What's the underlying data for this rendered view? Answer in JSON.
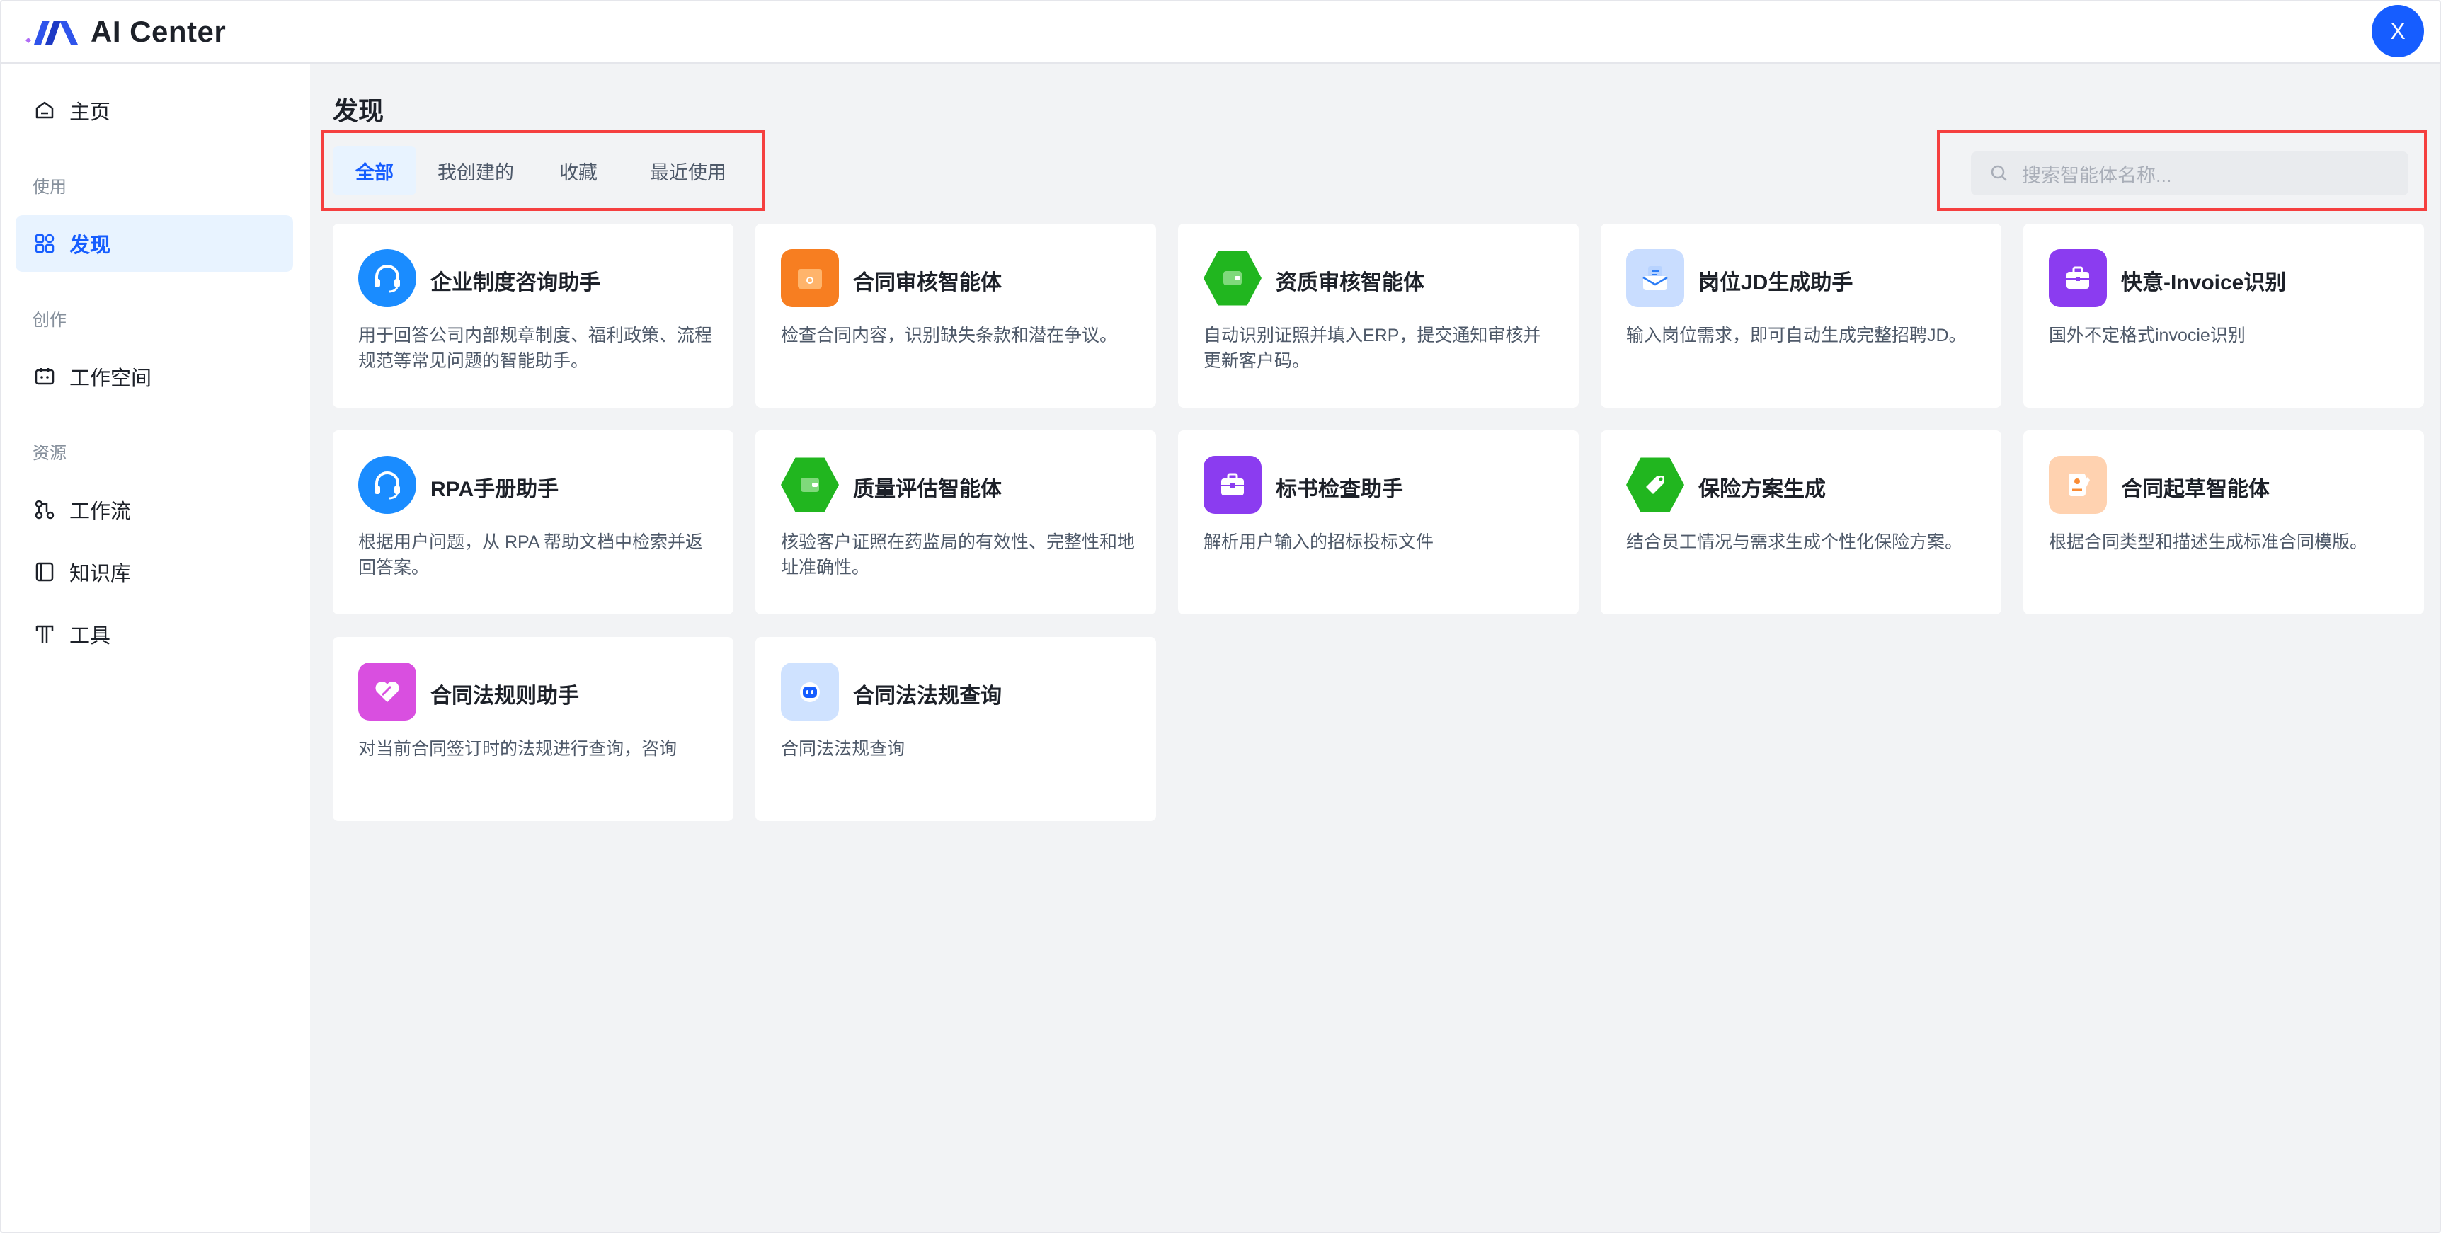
{
  "app": {
    "title": "AI Center",
    "avatar_letter": "X"
  },
  "sidebar": {
    "home": "主页",
    "group_use": "使用",
    "discover": "发现",
    "group_create": "创作",
    "workspace": "工作空间",
    "group_resources": "资源",
    "workflow": "工作流",
    "knowledge": "知识库",
    "tools": "工具"
  },
  "main": {
    "title": "发现",
    "tabs": [
      {
        "label": "全部",
        "active": true
      },
      {
        "label": "我创建的",
        "active": false
      },
      {
        "label": "收藏",
        "active": false
      },
      {
        "label": "最近使用",
        "active": false
      }
    ],
    "search": {
      "placeholder": "搜索智能体名称..."
    },
    "cards": [
      {
        "title": "企业制度咨询助手",
        "desc": "用于回答公司内部规章制度、福利政策、流程规范等常见问题的智能助手。",
        "icon": "headset-icon",
        "color": "#1a8cff"
      },
      {
        "title": "合同审核智能体",
        "desc": "检查合同内容，识别缺失条款和潜在争议。",
        "icon": "wallet-icon",
        "color": "#f77e21"
      },
      {
        "title": "资质审核智能体",
        "desc": "自动识别证照并填入ERP，提交通知审核并更新客户码。",
        "icon": "id-card-icon",
        "color": "#21b61f"
      },
      {
        "title": "岗位JD生成助手",
        "desc": "输入岗位需求，即可自动生成完整招聘JD。",
        "icon": "envelope-icon",
        "color": "#2b7cf6"
      },
      {
        "title": "快意-Invoice识别",
        "desc": "国外不定格式invocie识别",
        "icon": "toolbox-icon",
        "color": "#8b3cf0"
      },
      {
        "title": "RPA手册助手",
        "desc": "根据用户问题，从 RPA 帮助文档中检索并返回答案。",
        "icon": "headset-icon",
        "color": "#1a8cff"
      },
      {
        "title": "质量评估智能体",
        "desc": "核验客户证照在药监局的有效性、完整性和地址准确性。",
        "icon": "id-card-icon",
        "color": "#21b61f"
      },
      {
        "title": "标书检查助手",
        "desc": "解析用户输入的招标投标文件",
        "icon": "toolbox-icon",
        "color": "#8b3cf0"
      },
      {
        "title": "保险方案生成",
        "desc": "结合员工情况与需求生成个性化保险方案。",
        "icon": "tag-icon",
        "color": "#21b61f"
      },
      {
        "title": "合同起草智能体",
        "desc": "根据合同类型和描述生成标准合同模版。",
        "icon": "contract-icon",
        "color": "#fa8c35"
      },
      {
        "title": "合同法规则助手",
        "desc": "对当前合同签订时的法规进行查询，咨询",
        "icon": "heart-icon",
        "color": "#d94fe0"
      },
      {
        "title": "合同法法规查询",
        "desc": "合同法法规查询",
        "icon": "robot-icon",
        "color": "#3f8cff"
      }
    ]
  }
}
